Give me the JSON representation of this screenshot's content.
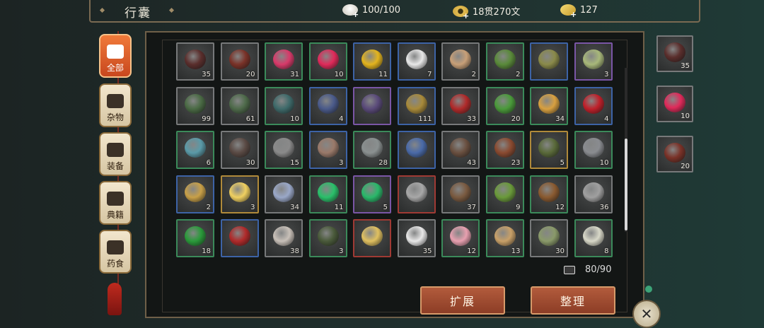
{
  "header": {
    "title": "行囊"
  },
  "resources": [
    {
      "name": "rice",
      "value": "100/100",
      "icon": "rice-bowl-icon"
    },
    {
      "name": "coins",
      "value": "18贯270文",
      "icon": "copper-coin-icon"
    },
    {
      "name": "gold",
      "value": "127",
      "icon": "gold-ingot-icon"
    }
  ],
  "tabs": [
    {
      "label": "全部",
      "icon": "grid-icon",
      "active": true
    },
    {
      "label": "杂物",
      "icon": "fan-icon",
      "active": false
    },
    {
      "label": "装备",
      "icon": "armor-icon",
      "active": false
    },
    {
      "label": "典籍",
      "icon": "book-icon",
      "active": false
    },
    {
      "label": "药食",
      "icon": "food-icon",
      "active": false
    }
  ],
  "items": [
    {
      "count": "35",
      "quality": "white",
      "icon": "dark-berries-icon",
      "color": "#5a2e2c"
    },
    {
      "count": "20",
      "quality": "white",
      "icon": "red-berries-icon",
      "color": "#7a3228"
    },
    {
      "count": "31",
      "quality": "green",
      "icon": "pink-fruit-icon",
      "color": "#d83a6a"
    },
    {
      "count": "10",
      "quality": "green",
      "icon": "pink-pill-icon",
      "color": "#e02a5a"
    },
    {
      "count": "11",
      "quality": "blue",
      "icon": "yellow-pill-icon",
      "color": "#e3b41e"
    },
    {
      "count": "7",
      "quality": "blue",
      "icon": "white-powder-icon",
      "color": "#e8e8e8"
    },
    {
      "count": "2",
      "quality": "white",
      "icon": "dumplings-icon",
      "color": "#c8a078"
    },
    {
      "count": "2",
      "quality": "green",
      "icon": "green-beans-dish-icon",
      "color": "#5a8a3a"
    },
    {
      "count": "",
      "quality": "blue",
      "icon": "stir-fry-dish-icon",
      "color": "#8a8a4a"
    },
    {
      "count": "3",
      "quality": "purple",
      "icon": "herb-dish-icon",
      "color": "#a8b87a"
    },
    {
      "count": "99",
      "quality": "white",
      "icon": "green-tree-stump-icon",
      "color": "#4a6a44"
    },
    {
      "count": "61",
      "quality": "white",
      "icon": "moss-tree-stump-icon",
      "color": "#4e6a4a"
    },
    {
      "count": "10",
      "quality": "green",
      "icon": "teal-tree-stump-icon",
      "color": "#3e6a6a"
    },
    {
      "count": "4",
      "quality": "blue",
      "icon": "blue-tree-stump-icon",
      "color": "#4a5a8a"
    },
    {
      "count": "",
      "quality": "purple",
      "icon": "purple-tree-stump-icon",
      "color": "#5a4a7a"
    },
    {
      "count": "111",
      "quality": "blue",
      "icon": "bell-icon",
      "color": "#a88a3a"
    },
    {
      "count": "33",
      "quality": "white",
      "icon": "red-flower-herb-icon",
      "color": "#b02a2a"
    },
    {
      "count": "20",
      "quality": "green",
      "icon": "green-herb-icon",
      "color": "#4a9a3a"
    },
    {
      "count": "34",
      "quality": "green",
      "icon": "ginseng-root-icon",
      "color": "#d8a040"
    },
    {
      "count": "4",
      "quality": "blue",
      "icon": "red-roses-icon",
      "color": "#c0202a"
    },
    {
      "count": "6",
      "quality": "green",
      "icon": "blue-berry-vine-icon",
      "color": "#5a9aa8"
    },
    {
      "count": "30",
      "quality": "white",
      "icon": "dark-ore-icon",
      "color": "#5a4a44"
    },
    {
      "count": "15",
      "quality": "green",
      "icon": "iron-ore-icon",
      "color": "#8a8a8a"
    },
    {
      "count": "3",
      "quality": "blue",
      "icon": "copper-ore-icon",
      "color": "#9a7a6a"
    },
    {
      "count": "28",
      "quality": "green",
      "icon": "gray-rock-icon",
      "color": "#8a9090"
    },
    {
      "count": "",
      "quality": "blue",
      "icon": "blue-crystal-rock-icon",
      "color": "#4a6aa8"
    },
    {
      "count": "43",
      "quality": "white",
      "icon": "wood-log-icon",
      "color": "#6a5040"
    },
    {
      "count": "23",
      "quality": "green",
      "icon": "wood-bundle-icon",
      "color": "#8a4a30"
    },
    {
      "count": "5",
      "quality": "gold",
      "icon": "mossy-log-icon",
      "color": "#5a6a3a"
    },
    {
      "count": "10",
      "quality": "green",
      "icon": "iron-ingot-icon",
      "color": "#8a8c90"
    },
    {
      "count": "2",
      "quality": "blue",
      "icon": "gold-plank-icon",
      "color": "#c8a048"
    },
    {
      "count": "3",
      "quality": "gold",
      "icon": "gold-bar-icon",
      "color": "#f0d060"
    },
    {
      "count": "34",
      "quality": "white",
      "icon": "rainbow-pearl-icon",
      "color": "#9aa8c8"
    },
    {
      "count": "11",
      "quality": "green",
      "icon": "jade-orb-icon",
      "color": "#2ac06a"
    },
    {
      "count": "5",
      "quality": "purple",
      "icon": "emerald-crystal-icon",
      "color": "#2ab86a"
    },
    {
      "count": "",
      "quality": "red",
      "icon": "silver-stone-icon",
      "color": "#a8a8a8"
    },
    {
      "count": "37",
      "quality": "white",
      "icon": "wooden-stick-icon",
      "color": "#7a5a40"
    },
    {
      "count": "9",
      "quality": "green",
      "icon": "bamboo-icon",
      "color": "#6a9a3a"
    },
    {
      "count": "12",
      "quality": "green",
      "icon": "wooden-bucket-icon",
      "color": "#8a5a30"
    },
    {
      "count": "36",
      "quality": "white",
      "icon": "gray-cloth-icon",
      "color": "#a0a0a0"
    },
    {
      "count": "18",
      "quality": "green",
      "icon": "green-cloth-icon",
      "color": "#2a9a3a"
    },
    {
      "count": "",
      "quality": "blue",
      "icon": "red-cloth-icon",
      "color": "#b02a2a"
    },
    {
      "count": "38",
      "quality": "white",
      "icon": "cotton-ball-icon",
      "color": "#c8c0b8"
    },
    {
      "count": "3",
      "quality": "green",
      "icon": "seeds-icon",
      "color": "#4a5a3a"
    },
    {
      "count": "",
      "quality": "red",
      "icon": "steamed-buns-icon",
      "color": "#e0c060"
    },
    {
      "count": "35",
      "quality": "white",
      "icon": "white-wine-jar-icon",
      "color": "#e8e8e8"
    },
    {
      "count": "12",
      "quality": "green",
      "icon": "pink-wine-jar-icon",
      "color": "#e8a0b0"
    },
    {
      "count": "13",
      "quality": "green",
      "icon": "rice-sack-icon",
      "color": "#c8a068"
    },
    {
      "count": "30",
      "quality": "white",
      "icon": "bronze-vessel-icon",
      "color": "#8a9a6a"
    },
    {
      "count": "8",
      "quality": "green",
      "icon": "white-cup-icon",
      "color": "#d8d8c8"
    }
  ],
  "capacity": {
    "label": "80/90",
    "icon": "chest-icon"
  },
  "buttons": {
    "expand": "扩展",
    "sort": "整理"
  },
  "side_slots": [
    {
      "count": "35",
      "icon": "dark-berries-icon",
      "color": "#5a2e2c"
    },
    {
      "count": "10",
      "icon": "pink-pill-icon",
      "color": "#e02a5a"
    },
    {
      "count": "20",
      "icon": "red-berries-icon",
      "color": "#7a3228"
    }
  ],
  "colors": {
    "panel_border": "#6f5f48",
    "button": "#a04a30",
    "active_tab": "#e0602a"
  }
}
